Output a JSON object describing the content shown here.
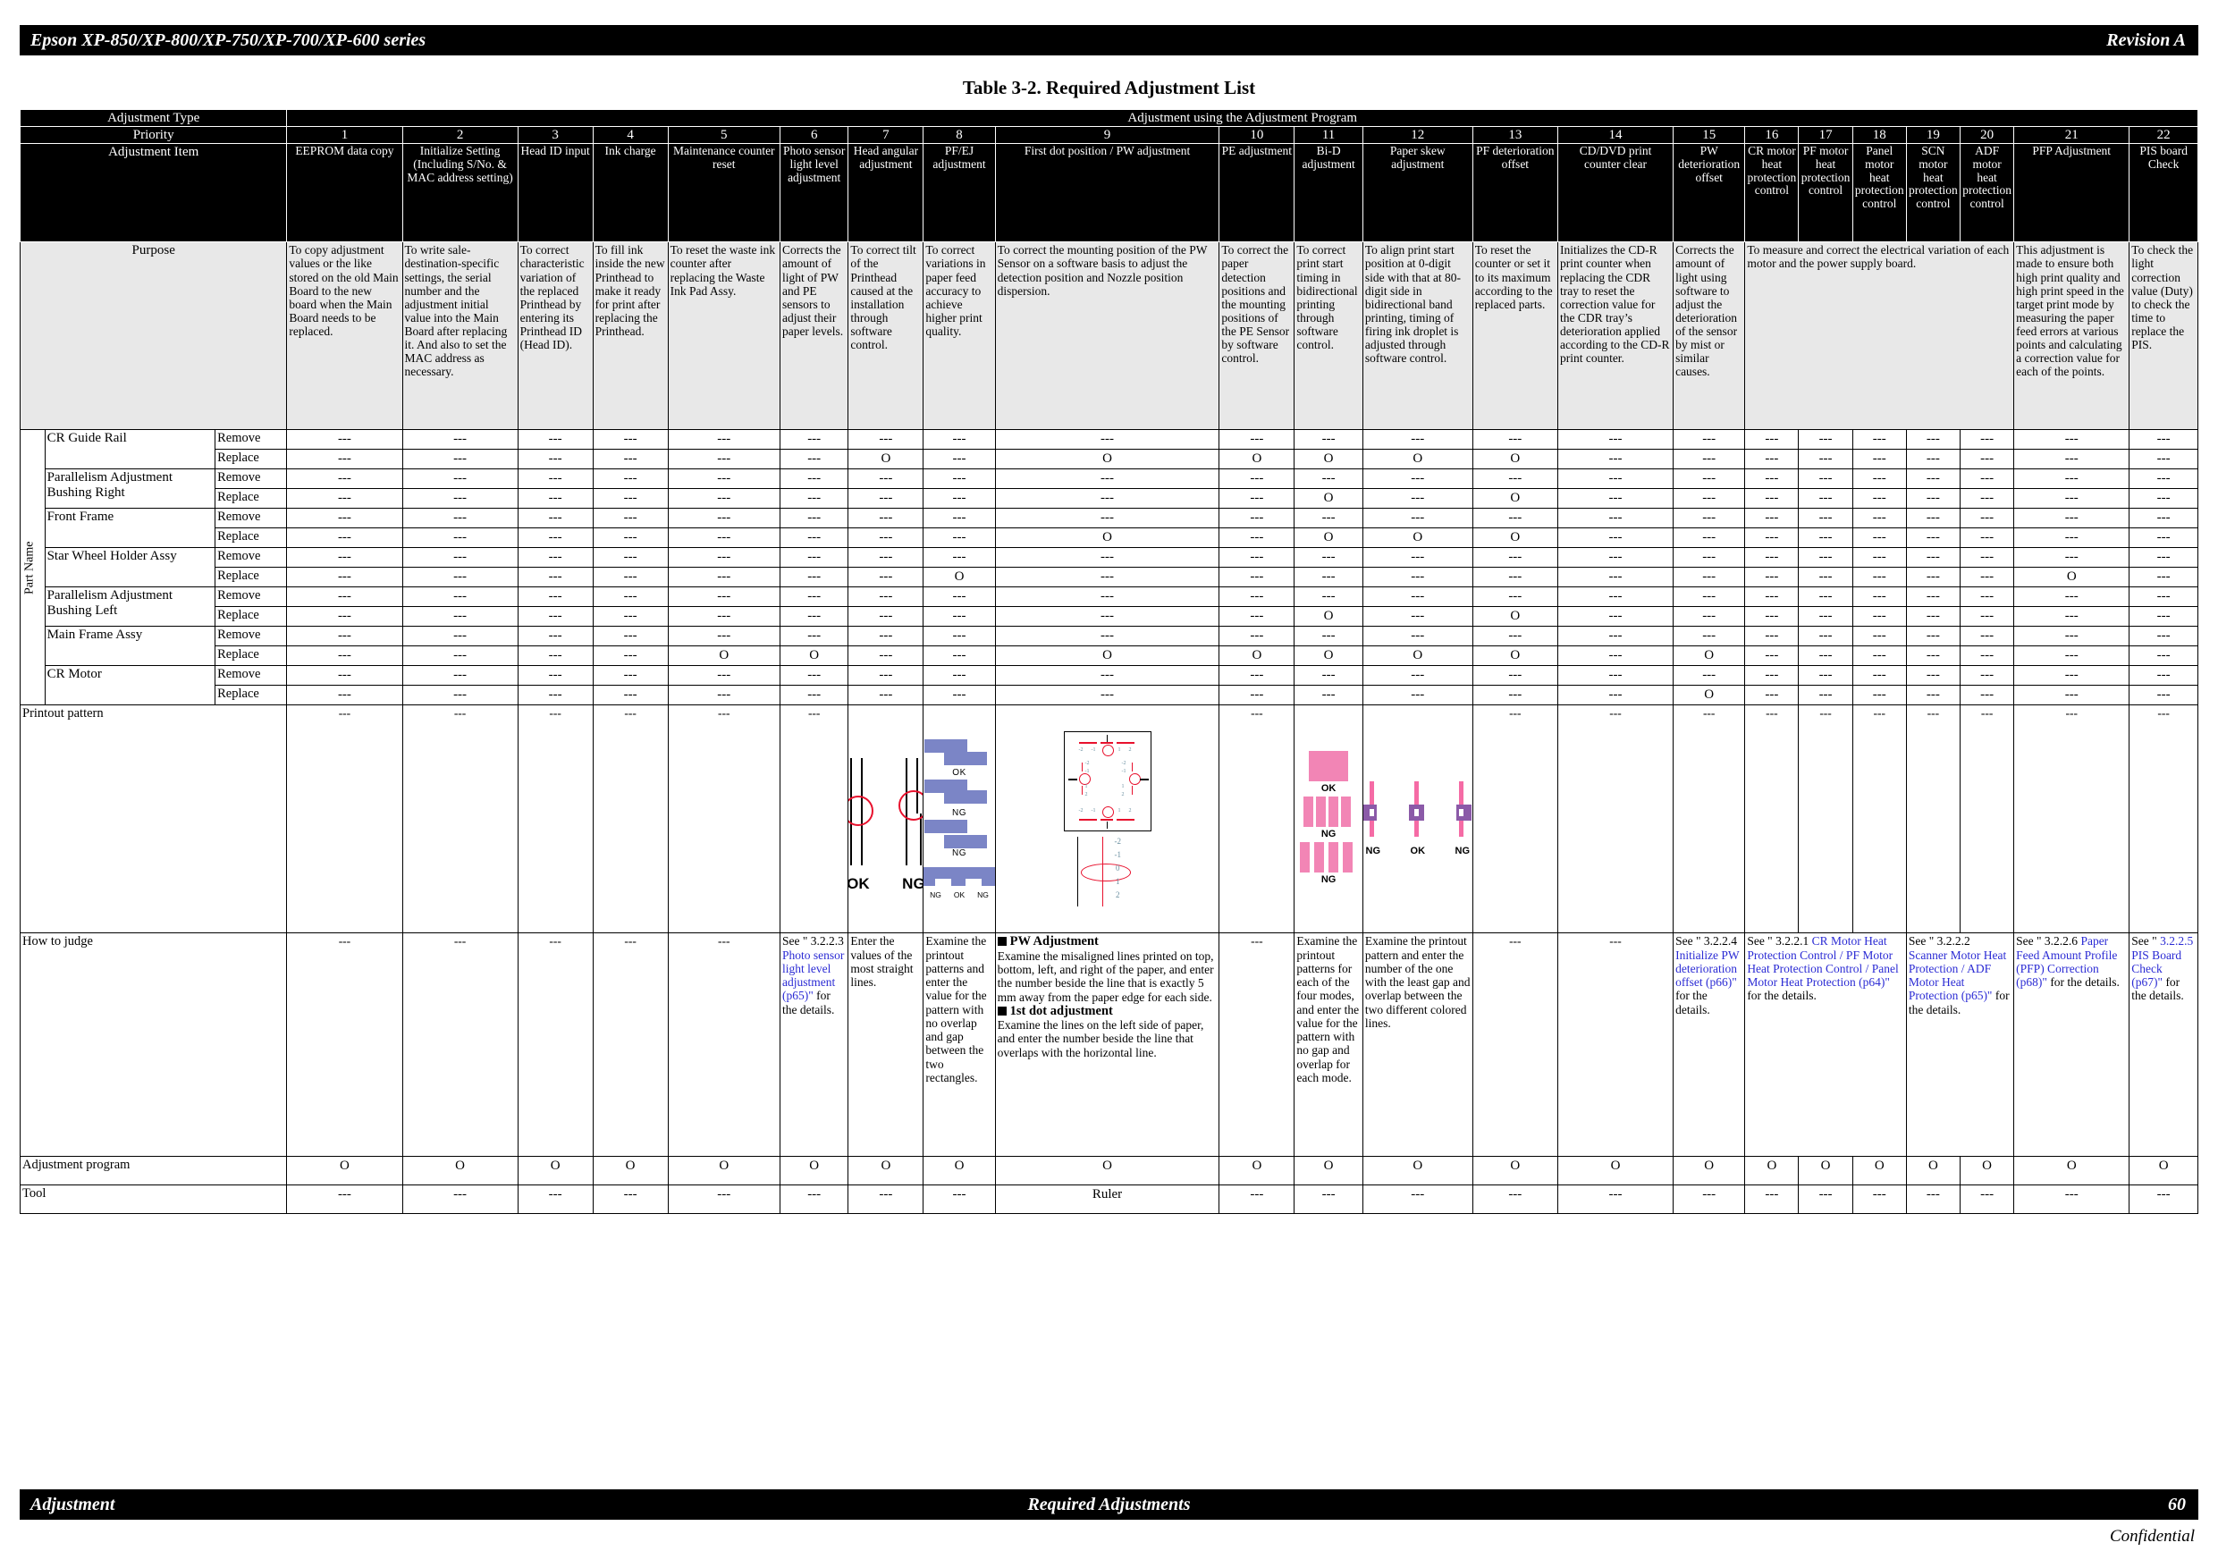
{
  "header": {
    "left": "Epson XP-850/XP-800/XP-750/XP-700/XP-600 series",
    "right": "Revision A"
  },
  "footer": {
    "left": "Adjustment",
    "center": "Required Adjustments",
    "right": "60",
    "confidential": "Confidential"
  },
  "table_title": "Table 3-2.  Required Adjustment List",
  "labels": {
    "adjustment_type": "Adjustment Type",
    "adjustment_program_group": "Adjustment using the Adjustment Program",
    "priority": "Priority",
    "adjustment_item": "Adjustment Item",
    "purpose": "Purpose",
    "part_name": "Part Name",
    "remove": "Remove",
    "replace": "Replace",
    "printout_pattern": "Printout pattern",
    "how_to_judge": "How to judge",
    "adjustment_program": "Adjustment program",
    "tool": "Tool"
  },
  "priorities": [
    "1",
    "2",
    "3",
    "4",
    "5",
    "6",
    "7",
    "8",
    "9",
    "10",
    "11",
    "12",
    "13",
    "14",
    "15",
    "16",
    "17",
    "18",
    "19",
    "20",
    "21",
    "22"
  ],
  "adjustment_items": [
    "EEPROM data copy",
    "Initialize Setting (Including S/No. & MAC address setting)",
    "Head ID input",
    "Ink charge",
    "Maintenance counter reset",
    "Photo sensor light level adjustment",
    "Head angular adjustment",
    "PF/EJ adjustment",
    "First dot position / PW adjustment",
    "PE adjustment",
    "Bi-D adjustment",
    "Paper skew adjustment",
    "PF deterioration offset",
    "CD/DVD print counter clear",
    "PW deterioration offset",
    "CR motor heat protection control",
    "PF motor heat protection control",
    "Panel motor heat protection control",
    "SCN motor heat protection control",
    "ADF motor heat protection control",
    "PFP Adjustment",
    "PIS board Check"
  ],
  "purposes": [
    "To copy adjustment values or the like stored on the old Main Board to the new board when the Main Board needs to be replaced.",
    "To write sale-destination-specific settings, the serial number and the adjustment initial value into the Main Board after replacing it. And also to set the MAC address as necessary.",
    "To correct characteristic variation of the replaced Printhead by entering its Printhead ID (Head ID).",
    "To fill ink inside the new Printhead to make it ready for print after replacing the Printhead.",
    "To reset the waste ink counter after replacing the Waste Ink Pad Assy.",
    "Corrects the amount of light of PW and PE sensors to adjust their paper levels.",
    "To correct tilt of the Printhead caused at the installation through software control.",
    "To correct variations in paper feed accuracy to achieve higher print quality.",
    "To correct the mounting position of the PW Sensor on a software basis to adjust the detection position and Nozzle position dispersion.",
    "To correct the paper detection positions and the mounting positions of the PE Sensor by software control.",
    "To correct print start timing in bidirectional printing through software control.",
    "To align print start position at 0-digit side with that at 80-digit side in bidirectional band printing, timing of firing ink droplet is adjusted through software control.",
    "To reset the counter or set it to its maximum according to the replaced parts.",
    "Initializes the CD-R print counter when replacing the CDR tray to reset the correction value for the CDR tray’s deterioration applied according to the CD-R print counter.",
    "Corrects the amount of light using software to adjust the deterioration of the sensor by mist or similar causes.",
    "To measure and correct the electrical variation of each motor and the power supply board.",
    "This adjustment is made to ensure both high print quality and high print speed in the target print mode by measuring the paper feed errors at various points and calculating a correction value for each of the points.",
    "To check the light correction value (Duty) to check the time to replace the PIS."
  ],
  "part_rows": [
    {
      "part": "CR Guide Rail",
      "action": "Remove",
      "marks": [
        "---",
        "---",
        "---",
        "---",
        "---",
        "---",
        "---",
        "---",
        "---",
        "---",
        "---",
        "---",
        "---",
        "---",
        "---",
        "---",
        "---",
        "---",
        "---",
        "---",
        "---",
        "---"
      ]
    },
    {
      "part": "CR Guide Rail",
      "action": "Replace",
      "marks": [
        "---",
        "---",
        "---",
        "---",
        "---",
        "---",
        "O",
        "---",
        "O",
        "O",
        "O",
        "O",
        "O",
        "---",
        "---",
        "---",
        "---",
        "---",
        "---",
        "---",
        "---",
        "---"
      ]
    },
    {
      "part": "Parallelism Adjustment Bushing Right",
      "action": "Remove",
      "marks": [
        "---",
        "---",
        "---",
        "---",
        "---",
        "---",
        "---",
        "---",
        "---",
        "---",
        "---",
        "---",
        "---",
        "---",
        "---",
        "---",
        "---",
        "---",
        "---",
        "---",
        "---",
        "---"
      ]
    },
    {
      "part": "Parallelism Adjustment Bushing Right",
      "action": "Replace",
      "marks": [
        "---",
        "---",
        "---",
        "---",
        "---",
        "---",
        "---",
        "---",
        "---",
        "---",
        "O",
        "---",
        "O",
        "---",
        "---",
        "---",
        "---",
        "---",
        "---",
        "---",
        "---",
        "---"
      ]
    },
    {
      "part": "Front Frame",
      "action": "Remove",
      "marks": [
        "---",
        "---",
        "---",
        "---",
        "---",
        "---",
        "---",
        "---",
        "---",
        "---",
        "---",
        "---",
        "---",
        "---",
        "---",
        "---",
        "---",
        "---",
        "---",
        "---",
        "---",
        "---"
      ]
    },
    {
      "part": "Front Frame",
      "action": "Replace",
      "marks": [
        "---",
        "---",
        "---",
        "---",
        "---",
        "---",
        "---",
        "---",
        "O",
        "---",
        "O",
        "O",
        "O",
        "---",
        "---",
        "---",
        "---",
        "---",
        "---",
        "---",
        "---",
        "---"
      ]
    },
    {
      "part": "Star Wheel Holder Assy",
      "action": "Remove",
      "marks": [
        "---",
        "---",
        "---",
        "---",
        "---",
        "---",
        "---",
        "---",
        "---",
        "---",
        "---",
        "---",
        "---",
        "---",
        "---",
        "---",
        "---",
        "---",
        "---",
        "---",
        "---",
        "---"
      ]
    },
    {
      "part": "Star Wheel Holder Assy",
      "action": "Replace",
      "marks": [
        "---",
        "---",
        "---",
        "---",
        "---",
        "---",
        "---",
        "O",
        "---",
        "---",
        "---",
        "---",
        "---",
        "---",
        "---",
        "---",
        "---",
        "---",
        "---",
        "---",
        "O",
        "---"
      ]
    },
    {
      "part": "Parallelism Adjustment Bushing Left",
      "action": "Remove",
      "marks": [
        "---",
        "---",
        "---",
        "---",
        "---",
        "---",
        "---",
        "---",
        "---",
        "---",
        "---",
        "---",
        "---",
        "---",
        "---",
        "---",
        "---",
        "---",
        "---",
        "---",
        "---",
        "---"
      ]
    },
    {
      "part": "Parallelism Adjustment Bushing Left",
      "action": "Replace",
      "marks": [
        "---",
        "---",
        "---",
        "---",
        "---",
        "---",
        "---",
        "---",
        "---",
        "---",
        "O",
        "---",
        "O",
        "---",
        "---",
        "---",
        "---",
        "---",
        "---",
        "---",
        "---",
        "---"
      ]
    },
    {
      "part": "Main Frame Assy",
      "action": "Remove",
      "marks": [
        "---",
        "---",
        "---",
        "---",
        "---",
        "---",
        "---",
        "---",
        "---",
        "---",
        "---",
        "---",
        "---",
        "---",
        "---",
        "---",
        "---",
        "---",
        "---",
        "---",
        "---",
        "---"
      ]
    },
    {
      "part": "Main Frame Assy",
      "action": "Replace",
      "marks": [
        "---",
        "---",
        "---",
        "---",
        "O",
        "O",
        "---",
        "---",
        "O",
        "O",
        "O",
        "O",
        "O",
        "---",
        "O",
        "---",
        "---",
        "---",
        "---",
        "---",
        "---",
        "---"
      ]
    },
    {
      "part": "CR Motor",
      "action": "Remove",
      "marks": [
        "---",
        "---",
        "---",
        "---",
        "---",
        "---",
        "---",
        "---",
        "---",
        "---",
        "---",
        "---",
        "---",
        "---",
        "---",
        "---",
        "---",
        "---",
        "---",
        "---",
        "---",
        "---"
      ]
    },
    {
      "part": "CR Motor",
      "action": "Replace",
      "marks": [
        "---",
        "---",
        "---",
        "---",
        "---",
        "---",
        "---",
        "---",
        "---",
        "---",
        "---",
        "---",
        "---",
        "---",
        "O",
        "---",
        "---",
        "---",
        "---",
        "---",
        "---",
        "---"
      ]
    }
  ],
  "printout_patterns": {
    "head_angular": {
      "ok": "OK",
      "ng": "NG"
    },
    "pf_ej": {
      "ok": "OK",
      "ng1": "NG",
      "ng2": "NG",
      "row": [
        "NG",
        "OK",
        "NG"
      ]
    },
    "first_dot": {
      "scale": [
        "-2",
        "-1",
        "0",
        "1",
        "2"
      ],
      "inner": [
        "-2",
        "-1",
        "1",
        "2"
      ],
      "side": [
        "-2",
        "-1",
        "1",
        "2"
      ]
    },
    "bi_d": {
      "ok": "OK",
      "ng1": "NG",
      "ng2": "NG"
    },
    "paper_skew": {
      "labels": [
        "NG",
        "OK",
        "NG"
      ]
    }
  },
  "how_to_judge": {
    "photo_sensor": {
      "pre": "See \" 3.2.2.3 ",
      "link": "Photo sensor light level adjustment (p65)\"",
      "post": " for the details."
    },
    "head_angular": "Enter the values of the most straight lines.",
    "pf_ej": "Examine the printout patterns and enter the value for the pattern with no overlap and gap between the two rectangles.",
    "first_dot": {
      "h1": "PW Adjustment",
      "p1": "Examine the misaligned lines printed on top, bottom, left, and right of the paper, and enter the number beside the line that is exactly 5 mm away from the paper edge for each side.",
      "h2": "1st dot adjustment",
      "p2": "Examine the lines on the left side of paper, and enter the number beside the line that overlaps with the horizontal line."
    },
    "bi_d": "Examine the printout patterns for each of the four modes, and enter the value for the pattern with no gap and overlap for each mode.",
    "paper_skew": "Examine the printout pattern and enter the number of the one with the least gap and overlap between the two different colored lines.",
    "pw_deterioration": {
      "pre": "See \" 3.2.2.4 ",
      "link": "Initialize PW deterioration offset (p66)\"",
      "post": " for the details."
    },
    "cr_motor_heat": {
      "pre": "See \" 3.2.2.1 ",
      "link": "CR Motor Heat Protection Control / PF Motor Heat Protection Control / Panel Motor Heat Protection (p64)\"",
      "post": " for the details."
    },
    "scanner_motor_heat": {
      "pre": "See \" 3.2.2.2 ",
      "link": "Scanner Motor Heat Protection / ADF Motor Heat Protection (p65)\"",
      "post": " for the details."
    },
    "pfp": {
      "pre": "See \" 3.2.2.6 ",
      "link": "Paper Feed Amount Profile (PFP) Correction (p68)\"",
      "post": " for the details."
    },
    "pis": {
      "pre": "See \" ",
      "link": "3.2.2.5 PIS Board Check (p67)\"",
      "post": " for the details."
    },
    "dash": "---"
  },
  "adjustment_program_row": [
    "O",
    "O",
    "O",
    "O",
    "O",
    "O",
    "O",
    "O",
    "O",
    "O",
    "O",
    "O",
    "O",
    "O",
    "O",
    "O",
    "O",
    "O",
    "O",
    "O",
    "O",
    "O"
  ],
  "tool_row": [
    "---",
    "---",
    "---",
    "---",
    "---",
    "---",
    "---",
    "---",
    "Ruler",
    "---",
    "---",
    "---",
    "---",
    "---",
    "---",
    "---",
    "---",
    "---",
    "---",
    "---",
    "---",
    "---"
  ],
  "colors": {
    "header_bar": "#000000",
    "purpose_bg": "#e8e8e8",
    "link": "#2b2bd4",
    "red": "#e8112d",
    "blue_block": "#7b85c6",
    "pink_block": "#f285b5",
    "purple_block": "#8b5aa8"
  }
}
